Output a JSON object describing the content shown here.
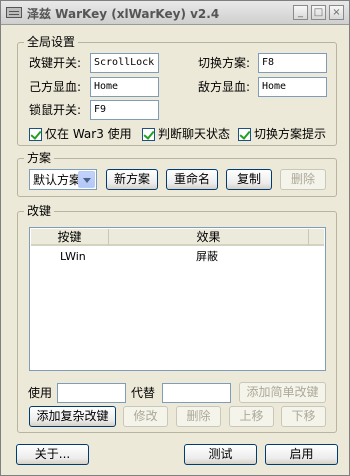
{
  "window": {
    "title": "泽兹 WarKey (xlWarKey) v2.4",
    "buttons": {
      "minimize": "_",
      "maximize": "□",
      "close": "×"
    }
  },
  "global": {
    "title": "全局设置",
    "remap_toggle": {
      "label": "改键开关:",
      "value": "ScrollLock"
    },
    "switch_scheme": {
      "label": "切换方案:",
      "value": "F8"
    },
    "own_hp": {
      "label": "己方显血:",
      "value": "Home"
    },
    "enemy_hp": {
      "label": "敌方显血:",
      "value": "Home"
    },
    "mouse_lock": {
      "label": "锁鼠开关:",
      "value": "F9"
    },
    "checkboxes": [
      {
        "label": "仅在 War3 使用",
        "checked": true
      },
      {
        "label": "判断聊天状态",
        "checked": true
      },
      {
        "label": "切换方案提示",
        "checked": true
      }
    ]
  },
  "scheme": {
    "title": "方案",
    "selected": "默认方案",
    "new_label": "新方案",
    "rename_label": "重命名",
    "copy_label": "复制",
    "delete_label": "删除"
  },
  "remap": {
    "title": "改键",
    "columns": [
      "按键",
      "效果"
    ],
    "rows": [
      {
        "key": "LWin",
        "effect": "屏蔽"
      }
    ],
    "use_label": "使用",
    "use_value": "",
    "replace_label": "代替",
    "replace_value": "",
    "add_simple_label": "添加简单改键",
    "add_complex_label": "添加复杂改键",
    "modify_label": "修改",
    "delete_label": "删除",
    "up_label": "上移",
    "down_label": "下移"
  },
  "footer": {
    "about_label": "关于...",
    "test_label": "测试",
    "enable_label": "启用"
  }
}
